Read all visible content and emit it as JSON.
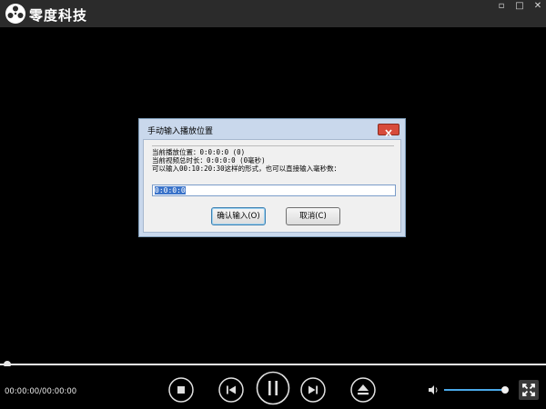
{
  "app": {
    "title": "零度科技"
  },
  "window_controls": {
    "minimize": "▫",
    "maximize": "□",
    "close": "✕"
  },
  "dialog": {
    "title": "手动输入播放位置",
    "info": [
      "当前播放位置：0:0:0:0 (0)",
      "当前视频总时长：0:0:0:0 (0毫秒)",
      "可以输入00:10:20:30这样的形式，也可以直接输入毫秒数："
    ],
    "input_value": "0:0:0:0",
    "ok_label": "确认输入(O)",
    "cancel_label": "取消(C)"
  },
  "player": {
    "timecode": "00:00:00/00:00:00",
    "progress": 0.0,
    "volume": 0.95
  },
  "colors": {
    "accent": "#4aa8e8",
    "titlebar": "#2b2b2b",
    "close": "#d74b3b"
  },
  "icons": [
    "logo-icon",
    "stop-icon",
    "previous-icon",
    "pause-icon",
    "next-icon",
    "eject-icon",
    "volume-icon",
    "fullscreen-icon",
    "close-icon"
  ]
}
